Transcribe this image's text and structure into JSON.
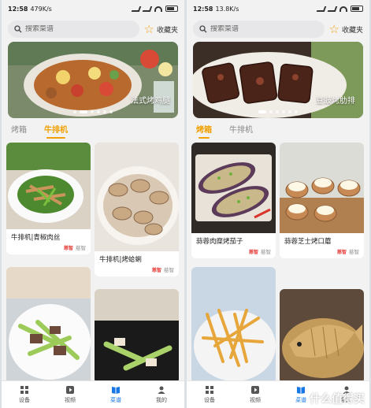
{
  "left": {
    "status": {
      "time": "12:58",
      "speed": "479K/s"
    },
    "search": {
      "placeholder": "搜索菜谱"
    },
    "favorites_label": "收藏夹",
    "banner": {
      "caption": "法式烤鸡腿",
      "dots": 6,
      "active_dot": 2
    },
    "tabs": [
      {
        "label": "烤箱",
        "active": false
      },
      {
        "label": "牛排机",
        "active": true
      }
    ],
    "cards": [
      {
        "title": "牛排机|青椒肉丝",
        "author": "慈智",
        "brand": "慈智"
      },
      {
        "title": "牛排机|烤蛤蜊",
        "author": "慈智",
        "brand": "慈智"
      },
      {
        "title": "",
        "author": "",
        "brand": ""
      },
      {
        "title": "",
        "author": "",
        "brand": ""
      }
    ],
    "nav": [
      {
        "label": "设备",
        "icon": "grid-icon",
        "active": false
      },
      {
        "label": "视频",
        "icon": "play-icon",
        "active": false
      },
      {
        "label": "菜谱",
        "icon": "book-icon",
        "active": true
      },
      {
        "label": "我的",
        "icon": "person-icon",
        "active": false
      }
    ]
  },
  "right": {
    "status": {
      "time": "12:58",
      "speed": "13.8K/s"
    },
    "search": {
      "placeholder": "搜索菜谱"
    },
    "favorites_label": "收藏夹",
    "banner": {
      "caption": "豆豉烤肋排",
      "dots": 6,
      "active_dot": 1
    },
    "tabs": [
      {
        "label": "烤箱",
        "active": true
      },
      {
        "label": "牛排机",
        "active": false
      }
    ],
    "cards": [
      {
        "title": "蒜蓉肉糜烤茄子",
        "author": "慈智",
        "brand": "慈智"
      },
      {
        "title": "蒜蓉芝士烤口蘑",
        "author": "慈智",
        "brand": "慈智"
      },
      {
        "title": "",
        "author": "",
        "brand": ""
      },
      {
        "title": "",
        "author": "",
        "brand": ""
      }
    ],
    "nav": [
      {
        "label": "设备",
        "icon": "grid-icon",
        "active": false
      },
      {
        "label": "视频",
        "icon": "play-icon",
        "active": false
      },
      {
        "label": "菜谱",
        "icon": "book-icon",
        "active": true
      },
      {
        "label": "我的",
        "icon": "person-icon",
        "active": false
      }
    ],
    "watermark": "什么值得买"
  },
  "colors": {
    "accent": "#f0a000",
    "nav_active": "#1677e5",
    "star": "#f3a51a"
  }
}
